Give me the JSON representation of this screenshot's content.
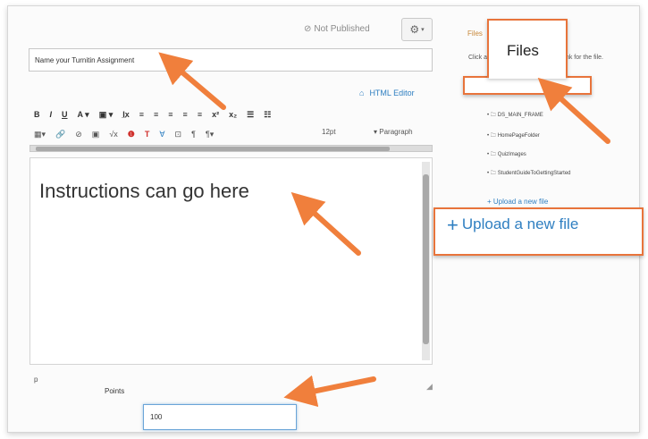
{
  "header": {
    "status": "Not Published",
    "settings_icon": "gear-icon"
  },
  "form": {
    "title_value": "Name your Turnitin Assignment",
    "html_editor_label": "HTML Editor",
    "font_size": "12pt",
    "block_format": "Paragraph",
    "editor_content": "Instructions can go here",
    "path_label": "p",
    "points_label": "Points",
    "points_value": "100"
  },
  "toolbar": {
    "row1": [
      "B",
      "I",
      "U",
      "A ▾",
      "▣ ▾",
      "I̲x",
      "≡",
      "≡",
      "≡",
      "≡",
      "≡",
      "x²",
      "x₂",
      "☰",
      "☷"
    ],
    "row2": [
      "▦▾",
      "🔗",
      "⊘",
      "▣",
      "√x",
      "❶",
      "T",
      "∀",
      "⊡",
      "¶",
      "¶▾"
    ]
  },
  "sidebar": {
    "tab_label": "Files",
    "description": "Click any file to insert a download link for the file.",
    "tree": [
      "DS_MAIN_FRAME",
      "HomePageFolder",
      "QuizImages",
      "StudentGuideToGettingStarted"
    ],
    "upload_label": "Upload a new file"
  },
  "callouts": {
    "files_title": "Files",
    "upload_label": "Upload a new file"
  },
  "colors": {
    "callout_border": "#e8743b",
    "arrow": "#f07f3c",
    "link_blue": "#2f7fc1"
  }
}
